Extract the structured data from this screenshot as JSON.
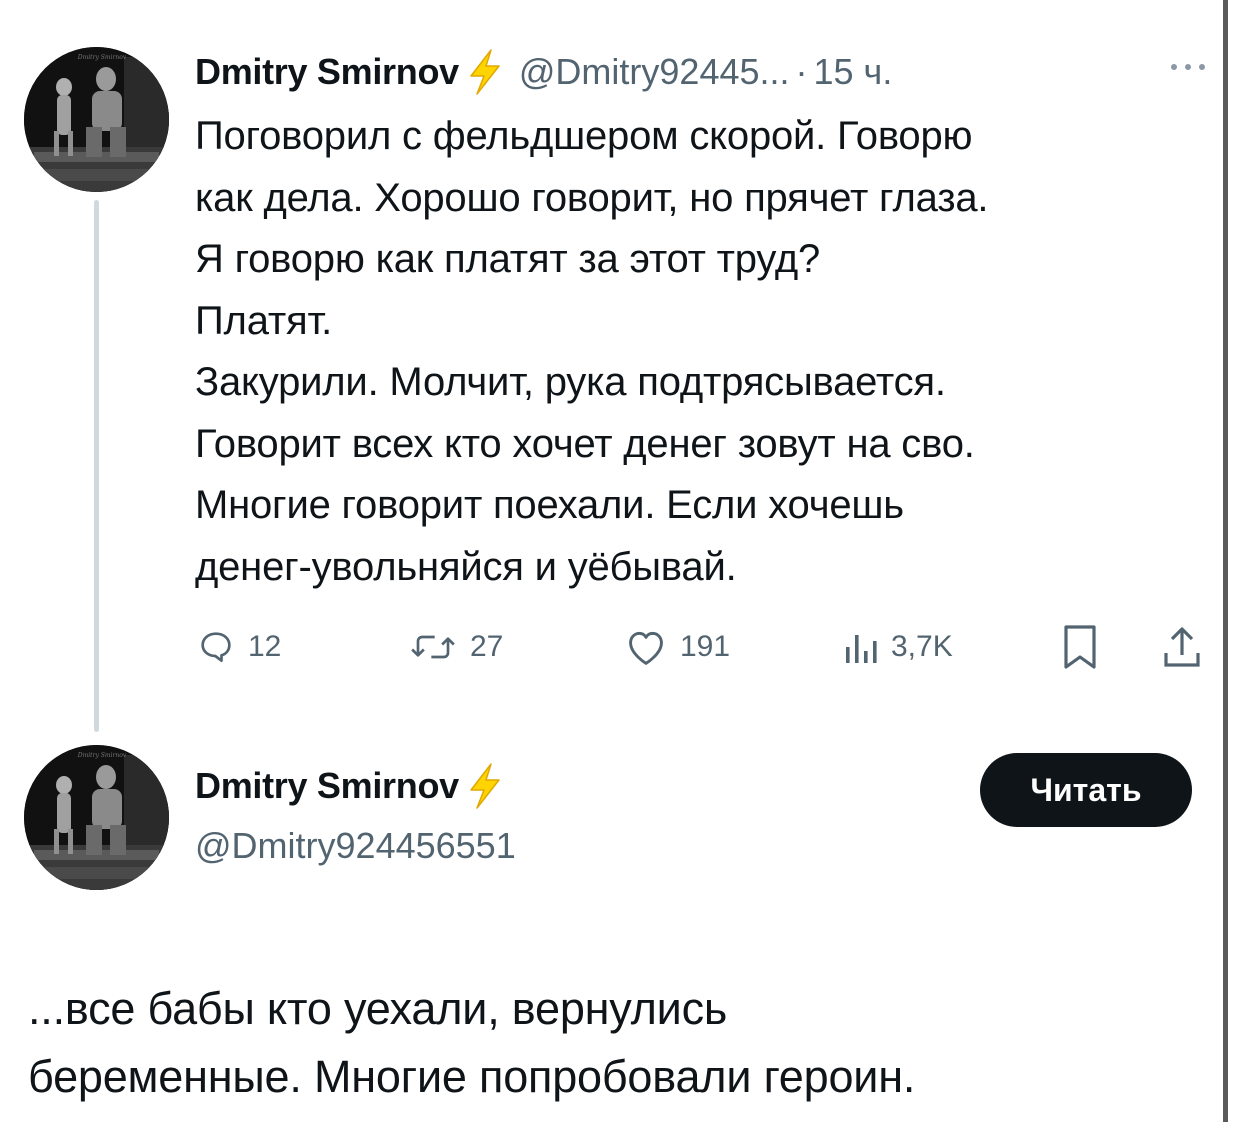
{
  "tweet": {
    "author": {
      "display_name": "Dmitry Smirnov",
      "handle": "@Dmitry92445...",
      "verified_icon": "bolt-icon"
    },
    "separator": "·",
    "time": "15 ч.",
    "text_lines": [
      "Поговорил с фельдшером скорой. Говорю",
      "как дела. Хорошо говорит, но прячет глаза.",
      "Я говорю как платят за этот труд?",
      "Платят.",
      "Закурили. Молчит, рука подтрясывается.",
      "Говорит всех кто хочет денег зовут на сво.",
      "Многие говорит поехали. Если хочешь",
      "денег-увольняйся и уёбывай."
    ],
    "actions": {
      "replies": "12",
      "retweets": "27",
      "likes": "191",
      "views": "3,7K"
    }
  },
  "profile_card": {
    "display_name": "Dmitry Smirnov",
    "handle": "@Dmitry924456551",
    "follow_label": "Читать",
    "bio_lines": [
      "...все бабы кто уехали, вернулись",
      "беременные. Многие попробовали героин."
    ]
  },
  "colors": {
    "text": "#0f1419",
    "secondary": "#536471",
    "bolt": "#ffd400",
    "button_bg": "#0f1419"
  }
}
